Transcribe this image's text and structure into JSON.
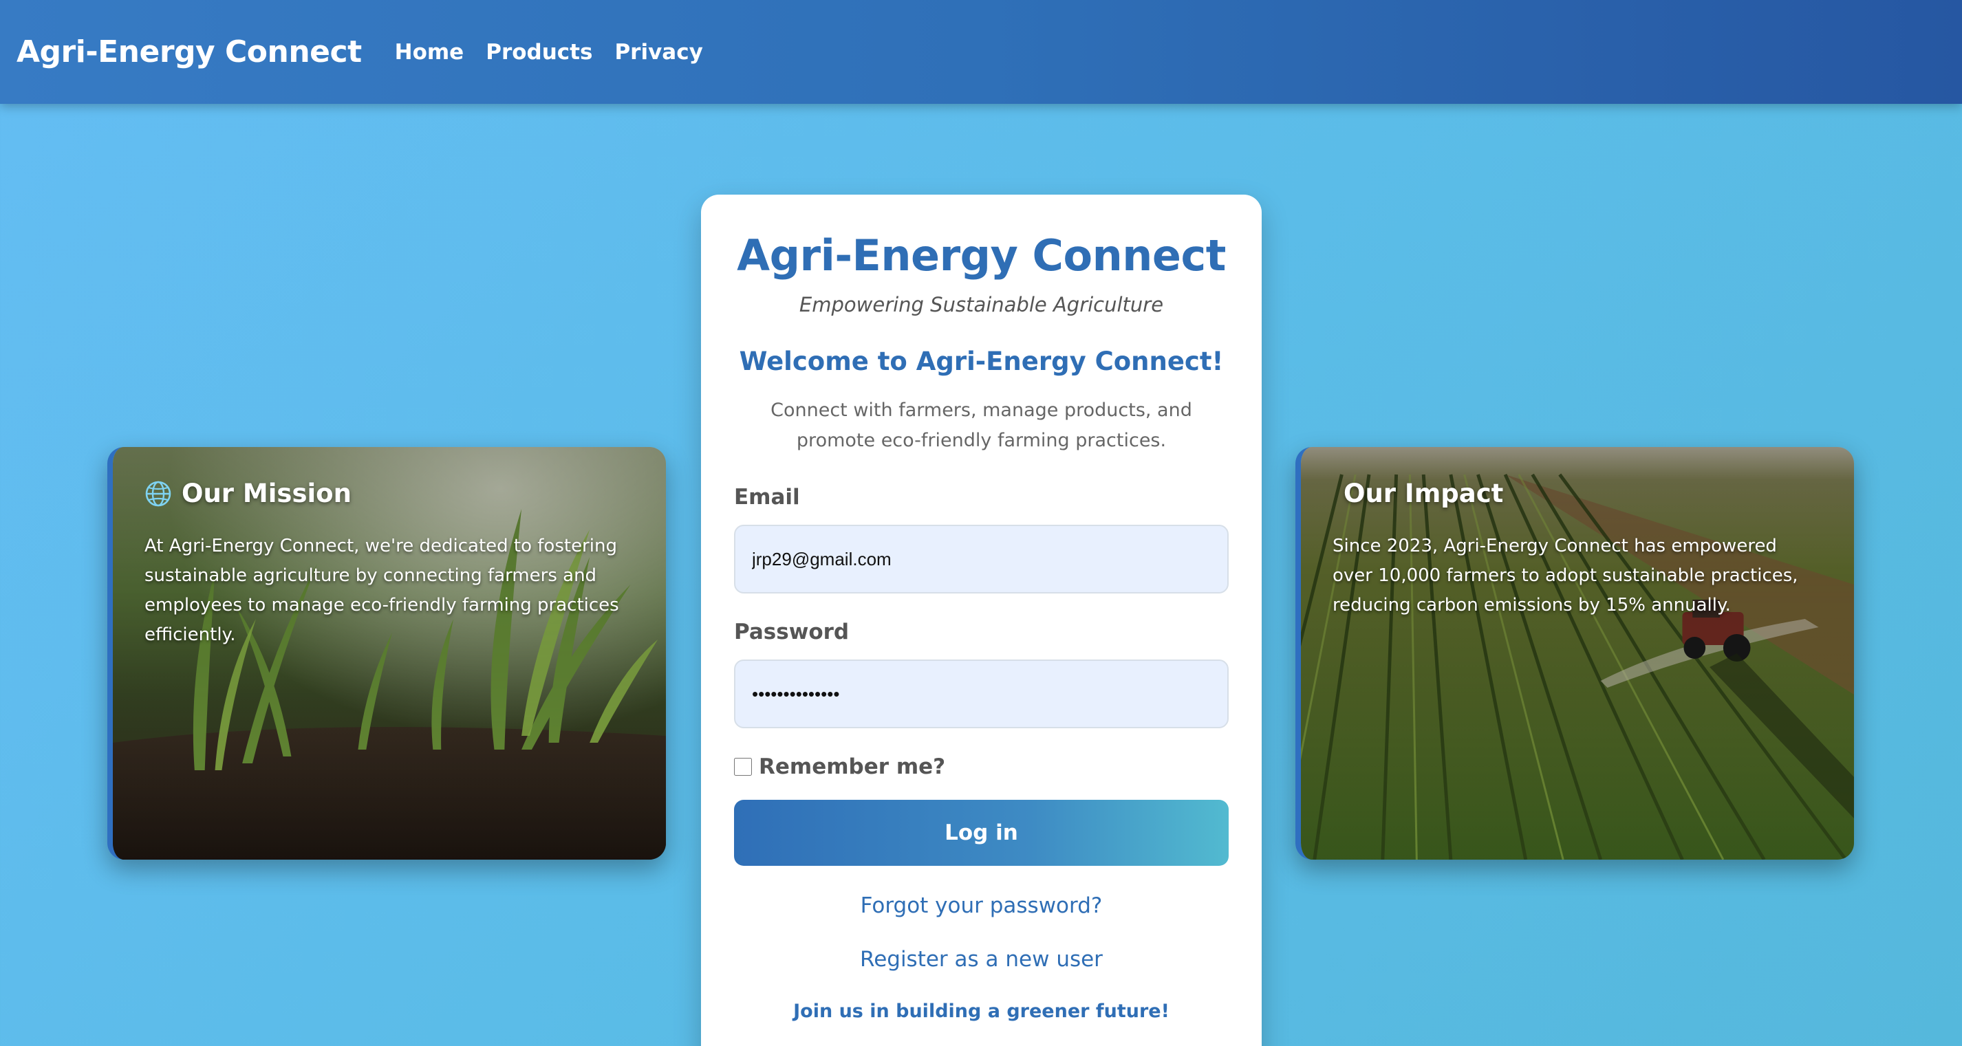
{
  "navbar": {
    "brand": "Agri-Energy Connect",
    "links": [
      "Home",
      "Products",
      "Privacy"
    ]
  },
  "mission_card": {
    "title": "Our Mission",
    "icon": "globe-icon",
    "text": "At Agri-Energy Connect, we're dedicated to fostering sustainable agriculture by connecting farmers and employees to manage eco-friendly farming practices efficiently."
  },
  "impact_card": {
    "title": "Our Impact",
    "text": "Since 2023, Agri-Energy Connect has empowered over 10,000 farmers to adopt sustainable practices, reducing carbon emissions by 15% annually."
  },
  "login": {
    "title": "Agri-Energy Connect",
    "tagline": "Empowering Sustainable Agriculture",
    "welcome_heading": "Welcome to Agri-Energy Connect!",
    "welcome_text": "Connect with farmers, manage products, and promote eco-friendly farming practices.",
    "email_label": "Email",
    "email_value": "jrp29@gmail.com",
    "password_label": "Password",
    "password_value": "••••••••••••••",
    "remember_label": "Remember me?",
    "login_button": "Log in",
    "forgot_link": "Forgot your password?",
    "register_link": "Register as a new user",
    "join_text": "Join us in building a greener future!"
  },
  "colors": {
    "navbar": "#2f70b8",
    "accent": "#2f6eb5",
    "background": "#5bbce8",
    "button_start": "#2f6fb7",
    "button_end": "#52bad0"
  }
}
